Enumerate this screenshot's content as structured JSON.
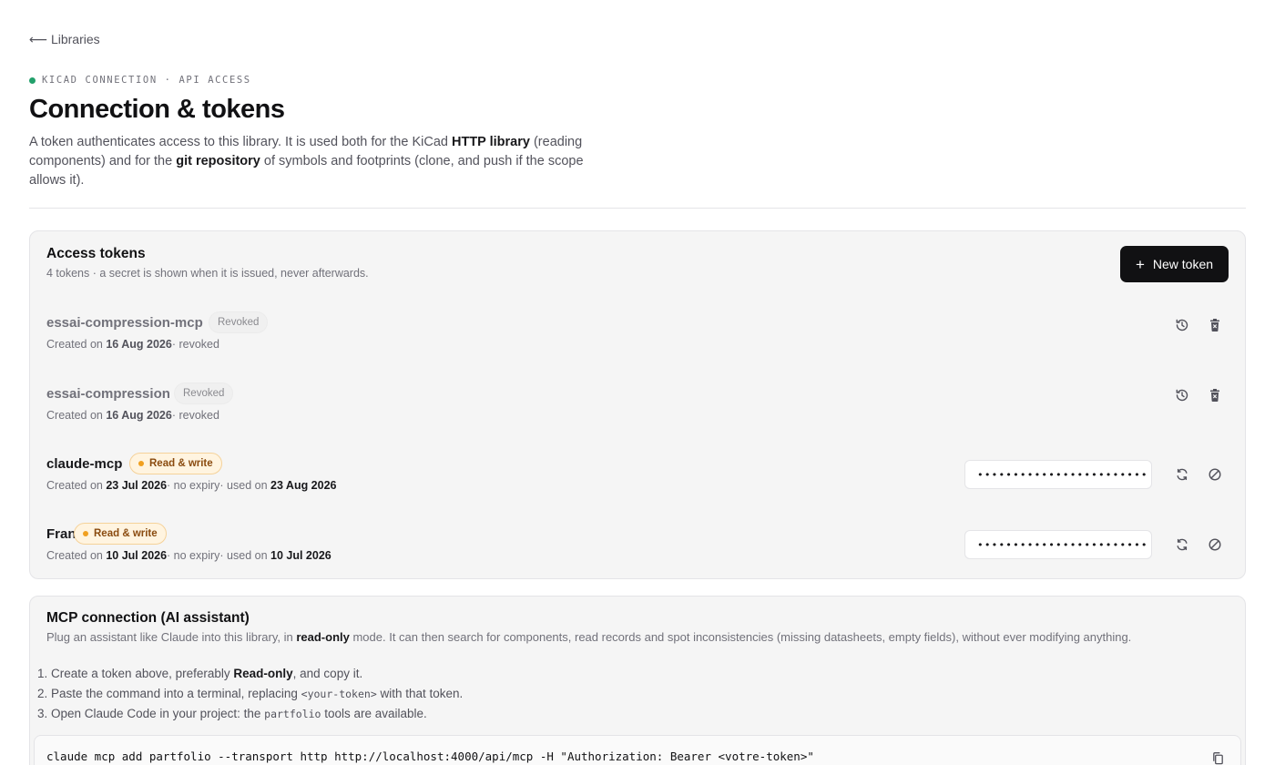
{
  "nav": {
    "back_label": "⟵ Libraries"
  },
  "header": {
    "eyebrow": "KICAD CONNECTION · API ACCESS",
    "title": "Connection & tokens",
    "intro": {
      "p1": "A token authenticates access to this library. It is used both for the KiCad ",
      "b1": "HTTP library",
      "p2": " (reading components) and for the ",
      "b2": "git repository",
      "p3": " of symbols and footprints (clone, and push if the scope allows it)."
    }
  },
  "tokens": {
    "title": "Access tokens",
    "subtitle": "4 tokens · a secret is shown when it is issued, never afterwards.",
    "new_button_icon": "plus-icon",
    "new_button_label": "New token",
    "items": [
      {
        "name": "essai-compression-mcp",
        "badge": "Revoked",
        "created_label": "Created on ",
        "created": "16 Aug 2026",
        "suffix": "· revoked",
        "actions": [
          "history-icon",
          "trash-icon"
        ]
      },
      {
        "name": "essai-compression",
        "badge": "Revoked",
        "created_label": "Created on ",
        "created": "16 Aug 2026",
        "suffix": "· revoked",
        "actions": [
          "history-icon",
          "trash-icon"
        ]
      },
      {
        "name": "claude-mcp",
        "badge": "Read & write",
        "created_label": "Created on ",
        "created": "23 Jul 2026",
        "expiry": "· no expiry",
        "used_label": "· used on ",
        "used": "23 Aug 2026",
        "secret_mask": "••••••••••••••••••••••••",
        "actions": [
          "regenerate-icon",
          "revoke-icon"
        ]
      },
      {
        "name": "Frans",
        "badge": "Read & write",
        "created_label": "Created on ",
        "created": "10 Jul 2026",
        "expiry": "· no expiry",
        "used_label": "· used on ",
        "used": "10 Jul 2026",
        "secret_mask": "••••••••••••••••••••••••",
        "actions": [
          "regenerate-icon",
          "revoke-icon"
        ]
      }
    ]
  },
  "mcp": {
    "title": "MCP connection (AI assistant)",
    "desc_a": "Plug an assistant like Claude into this library, in ",
    "desc_b": "read-only",
    "desc_c": " mode. It can then search for components, read records and spot inconsistencies (missing datasheets, empty fields), without ever modifying anything.",
    "steps": {
      "s1_a": "1. Create a token above, preferably ",
      "s1_b": "Read-only",
      "s1_c": ", and copy it.",
      "s2_a": "2. Paste the command into a terminal, replacing ",
      "s2_code": "<your-token>",
      "s2_c": " with that token.",
      "s3_a": "3. Open Claude Code in your project: the ",
      "s3_code": "partfolio",
      "s3_c": " tools are available."
    },
    "command": "claude mcp add partfolio --transport http http://localhost:4000/api/mcp -H \"Authorization: Bearer <votre-token>\"",
    "copy_icon": "copy-icon"
  },
  "colors": {
    "accent_dark": "#111113",
    "status_green": "#22a06b",
    "badge_rw_bg": "#fff4e0",
    "badge_rw_text": "#8a4b0f",
    "badge_rw_dot": "#f0a020"
  }
}
